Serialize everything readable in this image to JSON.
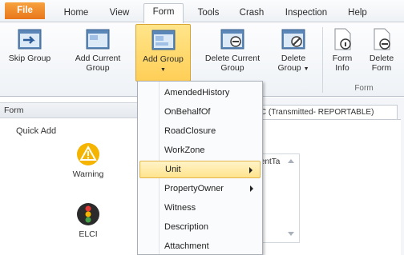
{
  "menu": {
    "tabs": [
      {
        "label": "File"
      },
      {
        "label": "Home"
      },
      {
        "label": "View"
      },
      {
        "label": "Form"
      },
      {
        "label": "Tools"
      },
      {
        "label": "Crash"
      },
      {
        "label": "Inspection"
      },
      {
        "label": "Help"
      }
    ],
    "active_tab": "Form"
  },
  "ribbon": {
    "buttons": {
      "skip_group": {
        "label": "Skip Group",
        "icon": "window-skip-icon"
      },
      "add_current_group": {
        "label": "Add Current Group",
        "icon": "window-add-icon"
      },
      "add_group": {
        "label": "Add Group",
        "icon": "window-add-group-icon"
      },
      "delete_current_group": {
        "label": "Delete Current Group",
        "icon": "window-delete-icon"
      },
      "delete_group": {
        "label": "Delete Group",
        "icon": "window-delete-group-icon"
      },
      "form_info": {
        "label": "Form Info",
        "icon": "document-info-icon"
      },
      "delete_form": {
        "label": "Delete Form",
        "icon": "document-delete-icon"
      }
    },
    "group_label_form": "Form"
  },
  "left_pane": {
    "title": "Form",
    "quick_add_label": "Quick Add",
    "items": [
      {
        "label": "Warning",
        "icon": "warning-icon"
      },
      {
        "label": "ELCI",
        "icon": "traffic-light-icon"
      }
    ]
  },
  "document": {
    "tab_label": "SNC (Transmitted- REPORTABLE)",
    "field_text": "umentTa"
  },
  "dropdown": {
    "items": [
      {
        "label": "AmendedHistory",
        "submenu": false
      },
      {
        "label": "OnBehalfOf",
        "submenu": false
      },
      {
        "label": "RoadClosure",
        "submenu": false
      },
      {
        "label": "WorkZone",
        "submenu": false
      },
      {
        "label": "Unit",
        "submenu": true
      },
      {
        "label": "PropertyOwner",
        "submenu": true
      },
      {
        "label": "Witness",
        "submenu": false
      },
      {
        "label": "Description",
        "submenu": false
      },
      {
        "label": "Attachment",
        "submenu": false
      }
    ],
    "highlighted": "Unit"
  },
  "colors": {
    "file_tab": "#e8761b",
    "pressed_button": "#ffcf57",
    "highlight_item": "#ffe38c"
  }
}
